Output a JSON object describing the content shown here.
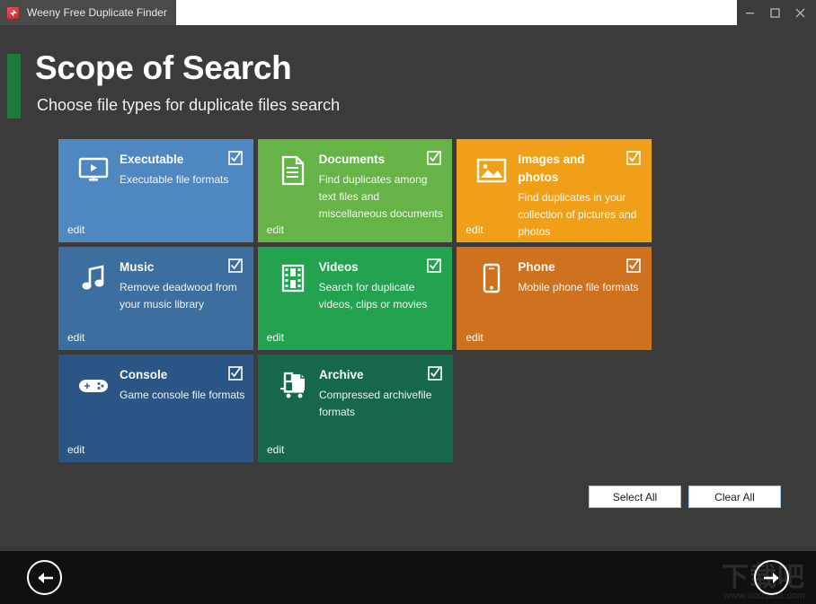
{
  "window": {
    "tab_title": "Weeny Free Duplicate Finder",
    "app_icon": "app-icon",
    "minimize_label": "Minimize",
    "maximize_label": "Maximize",
    "close_label": "Close"
  },
  "header": {
    "title": "Scope of Search",
    "subtitle": "Choose file types for duplicate files search",
    "accent_color": "#1d7a3d"
  },
  "tiles": [
    {
      "name": "executable",
      "title": "Executable",
      "desc": "Executable file formats",
      "edit_label": "edit",
      "color": "#4f87c0",
      "icon": "monitor-play-icon",
      "checked": true
    },
    {
      "name": "documents",
      "title": "Documents",
      "desc": "Find duplicates among text files and miscellaneous documents",
      "edit_label": "edit",
      "color": "#66b347",
      "icon": "document-icon",
      "checked": true
    },
    {
      "name": "images-and-photos",
      "title": "Images and photos",
      "desc": "Find duplicates in your collection of pictures and photos",
      "edit_label": "edit",
      "color": "#f0a018",
      "icon": "picture-icon",
      "checked": true
    },
    {
      "name": "music",
      "title": "Music",
      "desc": "Remove deadwood from your music library",
      "edit_label": "edit",
      "color": "#3c6ea0",
      "icon": "music-note-icon",
      "checked": true
    },
    {
      "name": "videos",
      "title": "Videos",
      "desc": "Search for duplicate videos, clips or movies",
      "edit_label": "edit",
      "color": "#23a34f",
      "icon": "film-strip-icon",
      "checked": true
    },
    {
      "name": "phone",
      "title": "Phone",
      "desc": "Mobile phone file formats",
      "edit_label": "edit",
      "color": "#cf7220",
      "icon": "smartphone-icon",
      "checked": true
    },
    {
      "name": "console",
      "title": "Console",
      "desc": "Game console file formats",
      "edit_label": "edit",
      "color": "#2a5584",
      "icon": "gamepad-icon",
      "checked": true
    },
    {
      "name": "archive",
      "title": "Archive",
      "desc": "Compressed archivefile formats",
      "edit_label": "edit",
      "color": "#16684b",
      "icon": "archive-cart-icon",
      "checked": true
    }
  ],
  "actions": {
    "select_all": "Select All",
    "clear_all": "Clear All"
  },
  "navigation": {
    "back_label": "Back",
    "next_label": "Next"
  },
  "watermark": {
    "cn_text": "下载吧",
    "url_text": "www.xiazaiba.com"
  }
}
